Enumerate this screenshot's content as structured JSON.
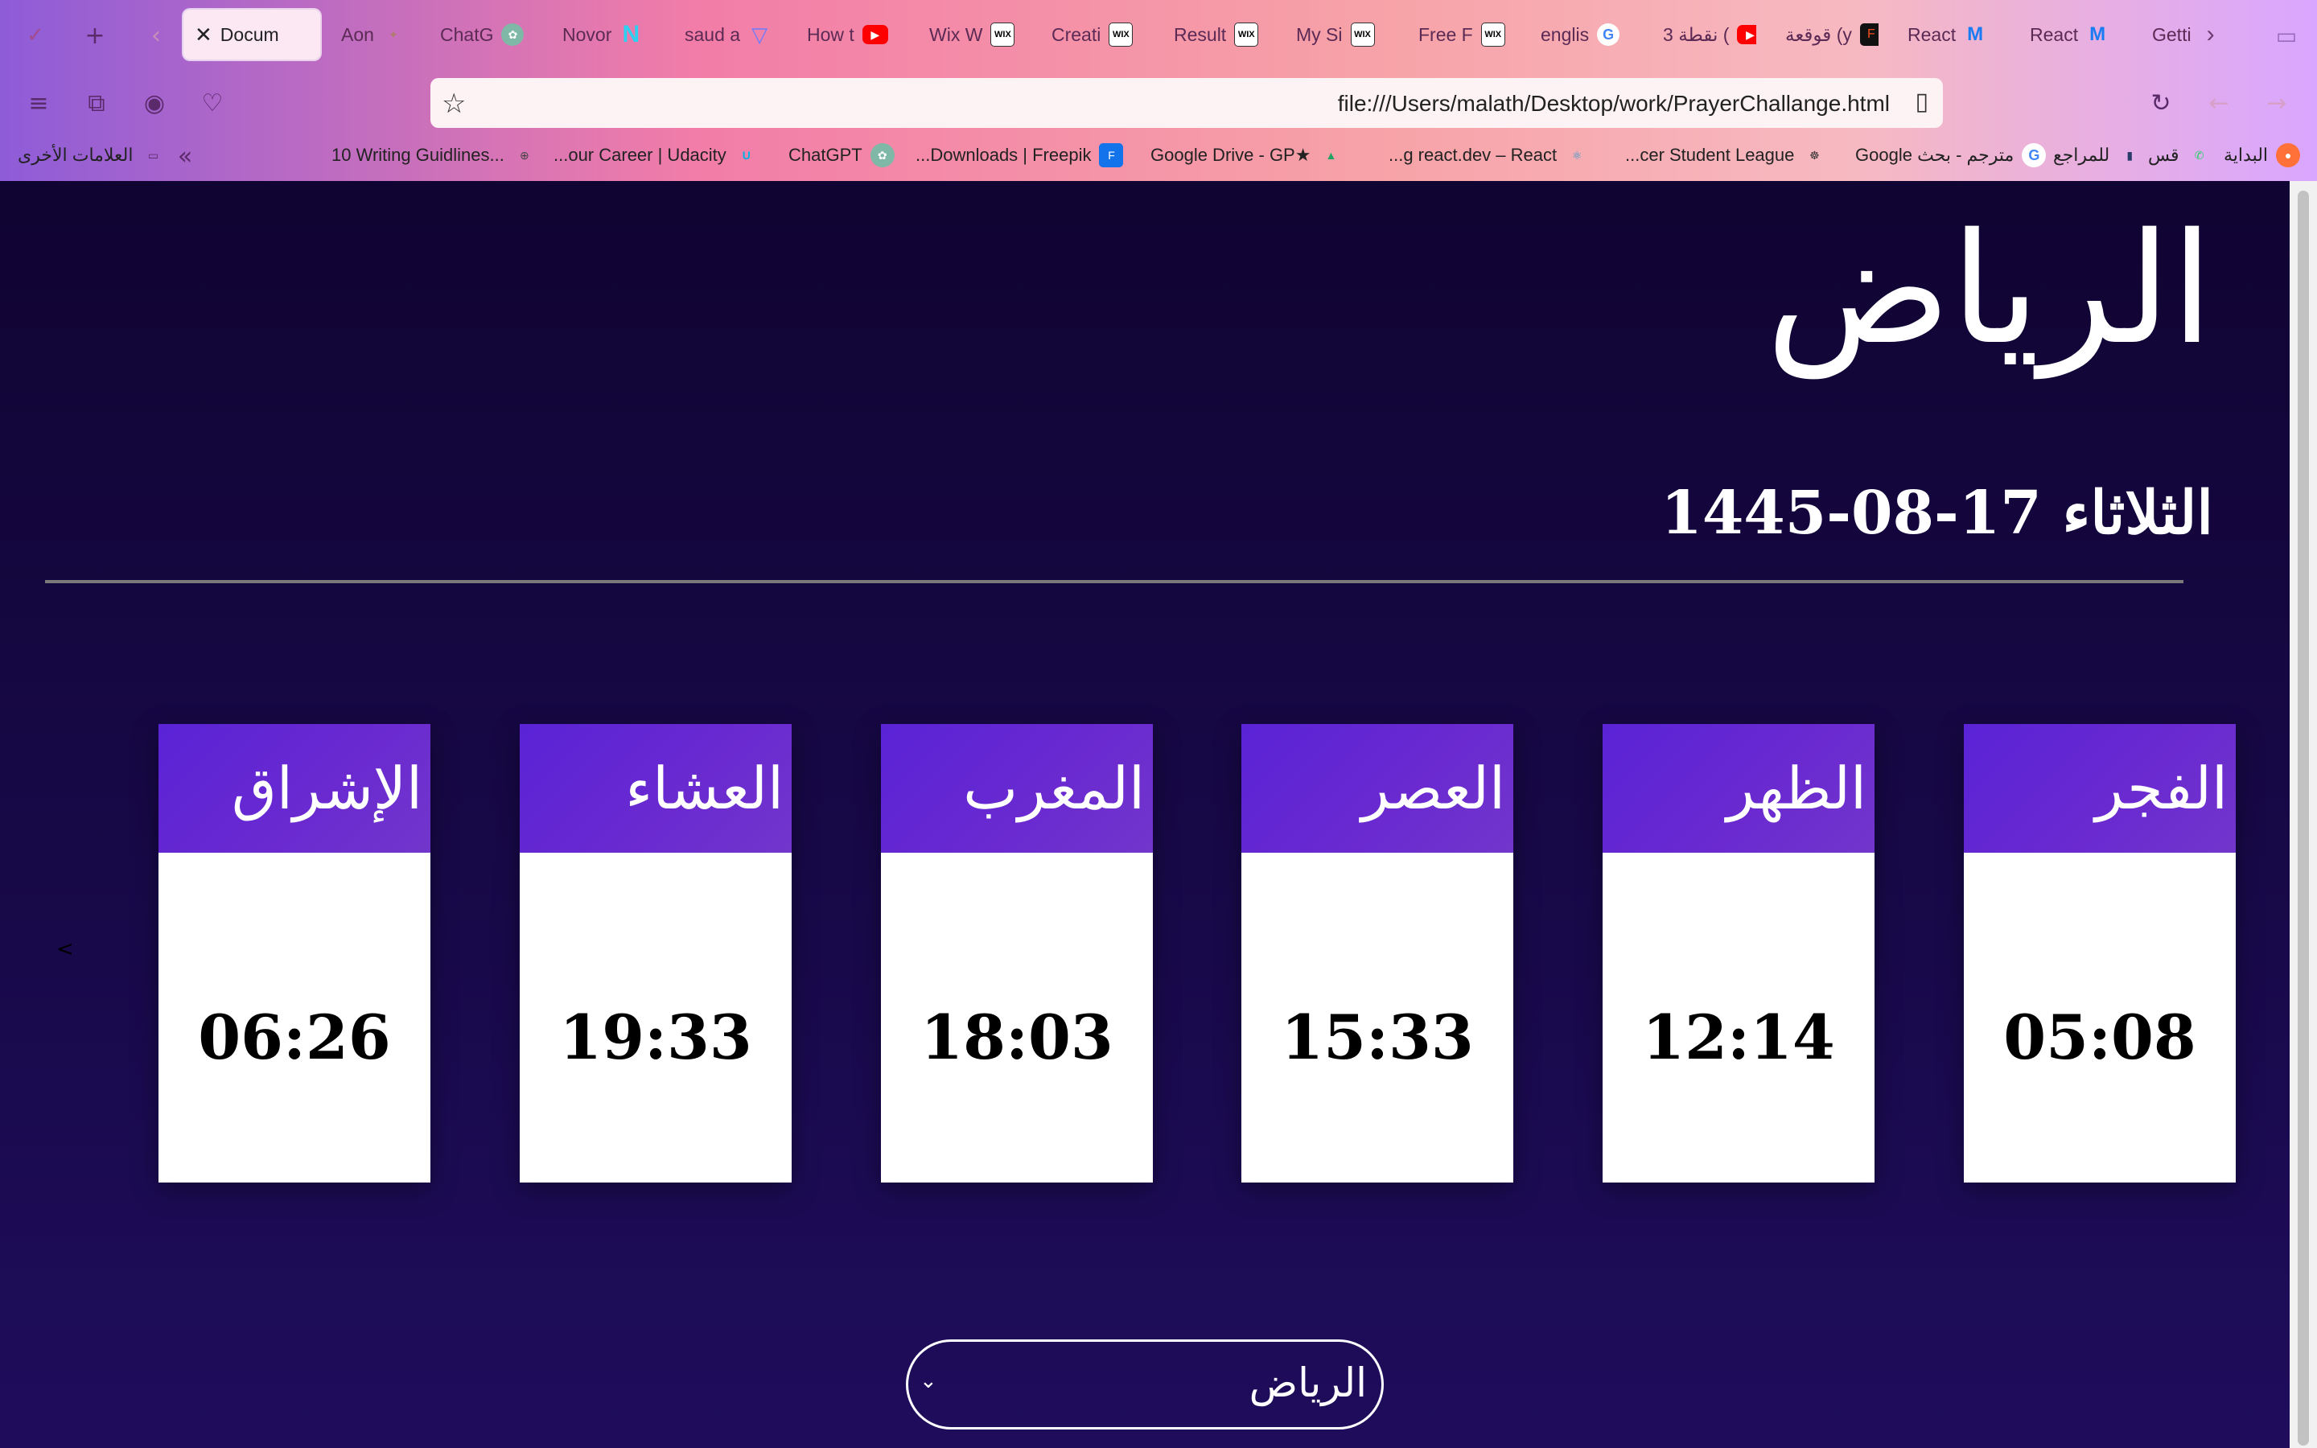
{
  "tabs": [
    {
      "label": "Docum",
      "icon": "close-icon",
      "active": true
    },
    {
      "label": "Aon",
      "icon": "aon-favicon-icon"
    },
    {
      "label": "ChatG",
      "icon": "chatgpt-icon"
    },
    {
      "label": "Novor",
      "icon": "novorender-icon"
    },
    {
      "label": "saud a",
      "icon": "vite-icon"
    },
    {
      "label": "How t",
      "icon": "youtube-icon"
    },
    {
      "label": "Wix W",
      "icon": "wix-icon"
    },
    {
      "label": "Creati",
      "icon": "wix-icon"
    },
    {
      "label": "Result",
      "icon": "wix-icon"
    },
    {
      "label": "My Si",
      "icon": "wix-icon"
    },
    {
      "label": "Free F",
      "icon": "wix-icon"
    },
    {
      "label": "englis",
      "icon": "google-icon"
    },
    {
      "label": "3 نقطة (",
      "icon": "youtube-icon"
    },
    {
      "label": "قوقعة (y",
      "icon": "figma-icon"
    },
    {
      "label": "React",
      "icon": "mui-icon"
    },
    {
      "label": "React",
      "icon": "mui-icon"
    },
    {
      "label": "Getti",
      "icon": "chevron-right-icon"
    }
  ],
  "toolbar": {
    "url": "file:///Users/malath/Desktop/work/PrayerChallange.html"
  },
  "bookmarks": [
    {
      "label": "البداية",
      "icon": "firefox-icon"
    },
    {
      "label": "قس",
      "icon": "whatsapp-icon"
    },
    {
      "label": "للمراجع",
      "icon": "book-icon"
    },
    {
      "label": "Google مترجم - بحث",
      "icon": "google-icon"
    },
    {
      "label": "...cer Student League",
      "icon": "league-icon"
    },
    {
      "label": "...g react.dev – React",
      "icon": "react-icon"
    },
    {
      "label": "Google Drive -  GP★",
      "icon": "google-drive-icon"
    },
    {
      "label": "...Downloads | Freepik",
      "icon": "freepik-icon"
    },
    {
      "label": "ChatGPT",
      "icon": "chatgpt-icon"
    },
    {
      "label": "...our Career | Udacity",
      "icon": "udacity-icon"
    },
    {
      "label": "10 Writing Guidlines...",
      "icon": "globe-icon"
    },
    {
      "label": "العلامات الأخرى",
      "icon": "folder-icon"
    }
  ],
  "page": {
    "city": "الرياض",
    "date": "الثلاثاء 17-08-1445",
    "prayers": [
      {
        "name": "الفجر",
        "time": "05:08"
      },
      {
        "name": "الظهر",
        "time": "12:14"
      },
      {
        "name": "العصر",
        "time": "15:33"
      },
      {
        "name": "المغرب",
        "time": "18:03"
      },
      {
        "name": "العشاء",
        "time": "19:33"
      },
      {
        "name": "الإشراق",
        "time": "06:26"
      }
    ],
    "prev_arrow": "<",
    "select": {
      "value": "الرياض"
    }
  }
}
